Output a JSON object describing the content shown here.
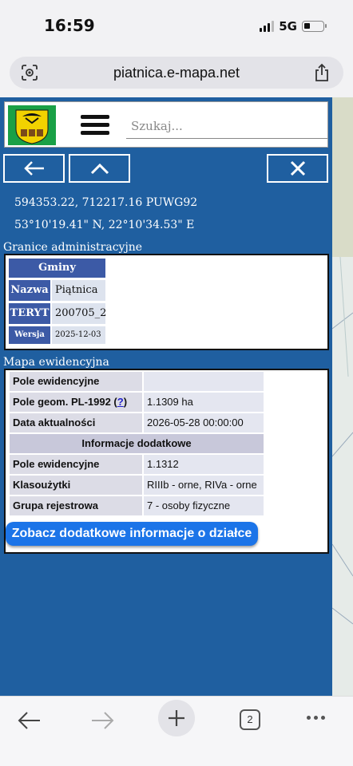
{
  "status_bar": {
    "time": "16:59",
    "network": "5G"
  },
  "browser": {
    "url": "piatnica.e-mapa.net",
    "tab_count": "2"
  },
  "search": {
    "placeholder": "Szukaj..."
  },
  "coordinates": {
    "puwg": "594353.22, 712217.16 PUWG92",
    "geo": "53°10'19.41\" N, 22°10'34.53\" E"
  },
  "granice": {
    "section_title": "Granice administracyjne",
    "table_title": "Gminy",
    "rows": [
      {
        "key": "Nazwa",
        "value": "Piątnica"
      },
      {
        "key": "TERYT",
        "value": "200705_2"
      },
      {
        "key": "Wersja",
        "value": "2025-12-03"
      }
    ]
  },
  "mapa": {
    "section_title": "Mapa ewidencyjna",
    "rows": [
      {
        "key": "Pole ewidencyjne",
        "value": ""
      },
      {
        "key": "Pole geom. PL-1992 (",
        "link": "?",
        "key_suffix": ")",
        "value": "1.1309 ha"
      },
      {
        "key": "Data aktualności",
        "value": "2026-05-28 00:00:00"
      }
    ],
    "extra_header": "Informacje dodatkowe",
    "extra_rows": [
      {
        "key": "Pole ewidencyjne",
        "value": "1.1312"
      },
      {
        "key": "Klasoużytki",
        "value": "RIIIb - orne, RIVa - orne"
      },
      {
        "key": "Grupa rejestrowa",
        "value": "7 - osoby fizyczne"
      }
    ],
    "more_button": "Zobacz dodatkowe informacje o działce"
  },
  "colors": {
    "panel": "#1f5fa0",
    "accent_button": "#1b74e8",
    "header_cell": "#3c5aa6"
  }
}
